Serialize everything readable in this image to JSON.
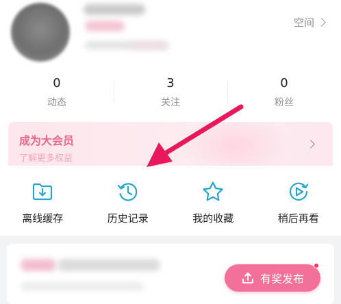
{
  "profile": {
    "space_label": "空间"
  },
  "stats": [
    {
      "value": "0",
      "label": "动态"
    },
    {
      "value": "3",
      "label": "关注"
    },
    {
      "value": "0",
      "label": "粉丝"
    }
  ],
  "vip": {
    "title": "成为大会员",
    "subtitle": "了解更多权益"
  },
  "actions": [
    {
      "label": "离线缓存",
      "icon": "download-folder-icon"
    },
    {
      "label": "历史记录",
      "icon": "history-clock-icon"
    },
    {
      "label": "我的收藏",
      "icon": "star-icon"
    },
    {
      "label": "稍后再看",
      "icon": "play-later-icon"
    }
  ],
  "publish": {
    "label": "有奖发布"
  },
  "colors": {
    "accent_pink": "#f3709a",
    "icon_teal": "#2aa3c9",
    "arrow_red": "#e8185c"
  }
}
